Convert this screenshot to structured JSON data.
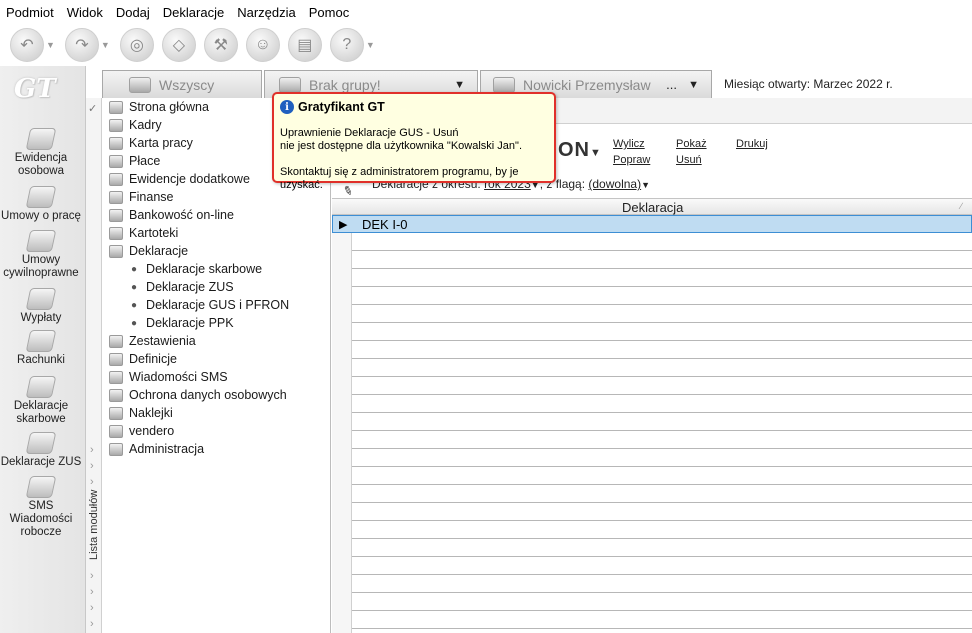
{
  "menu": [
    "Podmiot",
    "Widok",
    "Dodaj",
    "Deklaracje",
    "Narzędzia",
    "Pomoc"
  ],
  "logo": "GT",
  "left_nav": [
    {
      "label": "Ewidencja osobowa",
      "icon": "people-icon"
    },
    {
      "label": "Umowy o pracę",
      "icon": "contract-icon"
    },
    {
      "label": "Umowy cywilnoprawne",
      "icon": "civil-contract-icon"
    },
    {
      "label": "Wypłaty",
      "icon": "payout-icon"
    },
    {
      "label": "Rachunki",
      "icon": "bill-icon"
    },
    {
      "label": "Deklaracje skarbowe",
      "icon": "tax-declaration-icon"
    },
    {
      "label": "Deklaracje ZUS",
      "icon": "zus-icon"
    },
    {
      "label": "SMS Wiadomości robocze",
      "icon": "sms-icon"
    }
  ],
  "modules_label": "Lista modułów",
  "tabs": {
    "all": "Wszyscy",
    "group": "Brak grupy!",
    "person": "Nowicki Przemysław",
    "person_more": "...",
    "month_label": "Miesiąc otwarty:",
    "month_value": "Marzec 2022 r."
  },
  "tree": [
    {
      "label": "Strona główna",
      "sub": false
    },
    {
      "label": "Kadry",
      "sub": false
    },
    {
      "label": "Karta pracy",
      "sub": false
    },
    {
      "label": "Płace",
      "sub": false
    },
    {
      "label": "Ewidencje dodatkowe",
      "sub": false
    },
    {
      "label": "Finanse",
      "sub": false
    },
    {
      "label": "Bankowość on-line",
      "sub": false
    },
    {
      "label": "Kartoteki",
      "sub": false
    },
    {
      "label": "Deklaracje",
      "sub": false
    },
    {
      "label": "Deklaracje skarbowe",
      "sub": true
    },
    {
      "label": "Deklaracje ZUS",
      "sub": true
    },
    {
      "label": "Deklaracje GUS i PFRON",
      "sub": true
    },
    {
      "label": "Deklaracje PPK",
      "sub": true
    },
    {
      "label": "Zestawienia",
      "sub": false
    },
    {
      "label": "Definicje",
      "sub": false
    },
    {
      "label": "Wiadomości SMS",
      "sub": false
    },
    {
      "label": "Ochrona danych osobowych",
      "sub": false
    },
    {
      "label": "Naklejki",
      "sub": false
    },
    {
      "label": "vendero",
      "sub": false
    },
    {
      "label": "Administracja",
      "sub": false
    }
  ],
  "content": {
    "big_title_fragment": "ON",
    "actions": {
      "wylicz": "Wylicz",
      "popraw": "Popraw",
      "pokaz": "Pokaż",
      "usun": "Usuń",
      "drukuj": "Drukuj"
    },
    "filter": {
      "label_period": "Deklaracje z okresu:",
      "period_value": "rok 2023",
      "label_flag": ", z flagą:",
      "flag_value": "(dowolna)"
    },
    "grid": {
      "column": "Deklaracja",
      "rows": [
        "DEK I-0"
      ]
    }
  },
  "tooltip": {
    "title": "Gratyfikant GT",
    "line1": "Uprawnienie Deklaracje GUS - Usuń",
    "line2": "nie jest dostępne dla użytkownika \"Kowalski Jan\".",
    "line3": "Skontaktuj się z administratorem programu, by je uzyskać."
  }
}
